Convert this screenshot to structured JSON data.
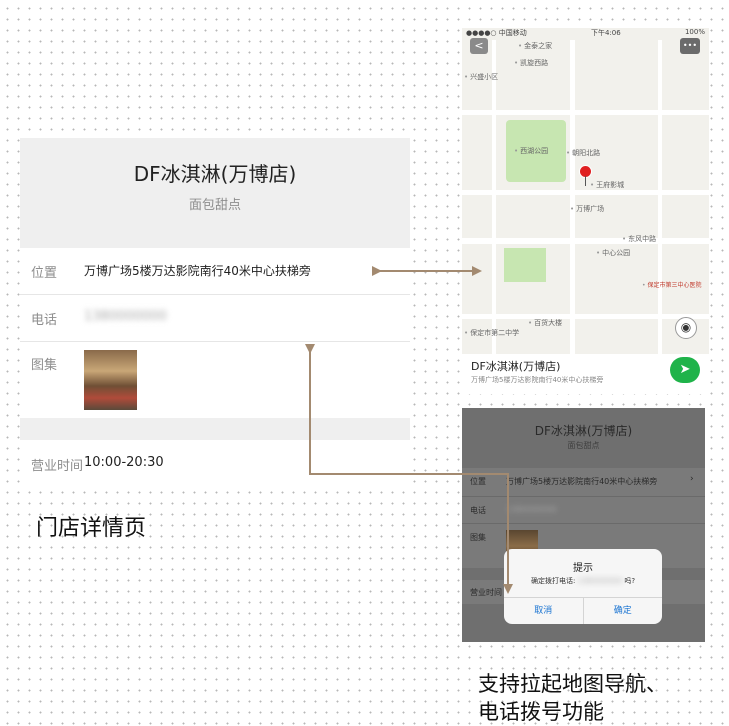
{
  "detail": {
    "title": "DF冰淇淋(万博店)",
    "category": "面包甜点",
    "rows": [
      {
        "label": "位置",
        "value": "万博广场5楼万达影院南行40米中心扶梯旁"
      },
      {
        "label": "电话",
        "value": "1380000000"
      },
      {
        "label": "图集",
        "value": ""
      },
      {
        "label": "营业时间",
        "value": "10:00-20:30"
      }
    ]
  },
  "caption_left": "门店详情页",
  "map": {
    "status_left": "●●●●○ 中国移动",
    "status_time": "下午4:06",
    "status_right": "100%",
    "back_label": "<",
    "more_label": "•••",
    "pois": [
      "金泰之家",
      "凯旋西路",
      "兴盛小区",
      "西湖公园",
      "朝阳北路",
      "王府影城",
      "万博广场",
      "中心公园",
      "保定市第三中心医院",
      "东风中路",
      "百货大楼",
      "保定市第二中学"
    ],
    "card_title": "DF冰淇淋(万博店)",
    "card_subtitle": "万博广场5楼万达影院南行40米中心扶梯旁"
  },
  "dim": {
    "title": "DF冰淇淋(万博店)",
    "category": "面包甜点",
    "rows": [
      {
        "label": "位置",
        "value": "万博广场5楼万达影院南行40米中心扶梯旁"
      },
      {
        "label": "电话",
        "value": "1380000000"
      },
      {
        "label": "图集",
        "value": ""
      },
      {
        "label": "营业时间",
        "value": ""
      }
    ]
  },
  "dialog": {
    "title": "提示",
    "message_prefix": "确定拨打电话:",
    "message_phone": "1380000000",
    "message_suffix": "吗?",
    "cancel": "取消",
    "confirm": "确定"
  },
  "caption_right_line1": "支持拉起地图导航、",
  "caption_right_line2": "电话拨号功能"
}
